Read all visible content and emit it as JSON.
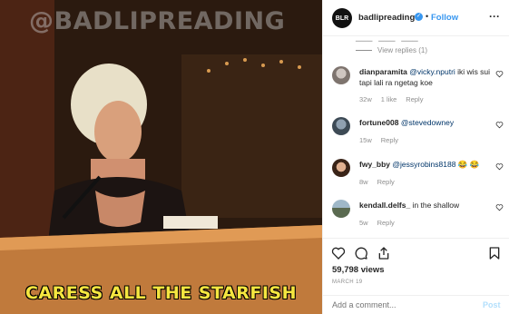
{
  "media": {
    "watermark": "@BADLIPREADING",
    "caption": "CARESS ALL THE STARFISH"
  },
  "header": {
    "avatar_text": "BLR",
    "username": "badlipreading",
    "follow": "Follow"
  },
  "view_replies": "View replies (1)",
  "comments": [
    {
      "user": "dianparamita",
      "mention": "@vicky.nputri",
      "text": " iki wis sui tapi lali ra ngetag koe",
      "time": "32w",
      "likes": "1 like",
      "reply": "Reply"
    },
    {
      "user": "fortune008",
      "mention": "@stevedowney",
      "text": "",
      "time": "15w",
      "likes": "",
      "reply": "Reply"
    },
    {
      "user": "fwy_bby",
      "mention": "@jessyrobins8188",
      "text": " 😂 😂",
      "time": "8w",
      "likes": "",
      "reply": "Reply"
    },
    {
      "user": "kendall.delfs_",
      "mention": "",
      "text": " in the shallow",
      "time": "5w",
      "likes": "",
      "reply": "Reply"
    }
  ],
  "stats": {
    "views": "59,798 views",
    "date": "MARCH 19"
  },
  "add_comment": {
    "placeholder": "Add a comment...",
    "post": "Post"
  }
}
